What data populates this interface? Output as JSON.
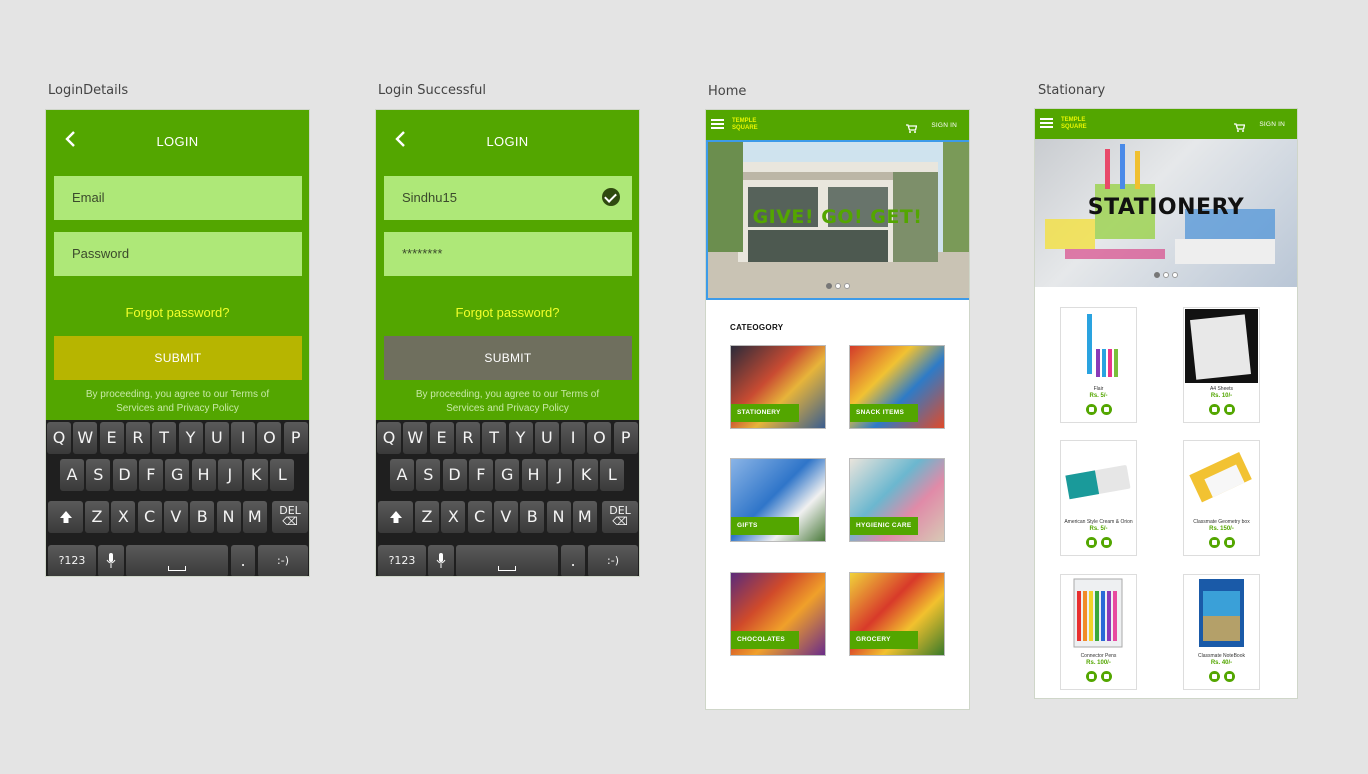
{
  "artboards": {
    "login_details": "LoginDetails",
    "login_success": "Login Successful",
    "home": "Home",
    "stationary": "Stationary"
  },
  "login_details": {
    "title": "LOGIN",
    "email_placeholder": "Email",
    "password_placeholder": "Password",
    "forgot": "Forgot password?",
    "submit": "SUBMIT",
    "terms": "By proceeding, you agree to our Terms of Services and Privacy Policy"
  },
  "login_success": {
    "title": "LOGIN",
    "username": "Sindhu15",
    "password": "********",
    "forgot": "Forgot password?",
    "submit": "SUBMIT",
    "terms": "By proceeding, you agree to our Terms of Services and Privacy Policy"
  },
  "keyboard": {
    "row1": [
      "Q",
      "W",
      "E",
      "R",
      "T",
      "Y",
      "U",
      "I",
      "O",
      "P"
    ],
    "row2": [
      "A",
      "S",
      "D",
      "F",
      "G",
      "H",
      "J",
      "K",
      "L"
    ],
    "row3": [
      "Z",
      "X",
      "C",
      "V",
      "B",
      "N",
      "M"
    ],
    "del": "DEL",
    "num": "?123",
    "period": ".",
    "smiley": ":-)"
  },
  "home": {
    "brand": "TEMPLE SQUARE",
    "sign_in": "SIGN IN",
    "hero_text": "GIVE! GO! GET!",
    "category_title": "CATEOGORY",
    "categories": [
      "STATIONERY",
      "SNACK ITEMS",
      "GIFTS",
      "HYGIENIC CARE",
      "CHOCOLATES",
      "GROCERY"
    ]
  },
  "stationary": {
    "brand": "TEMPLE SQUARE",
    "sign_in": "SIGN IN",
    "hero_text": "STATIONERY",
    "products": [
      {
        "name": "Flair",
        "price": "Rs. 5/-"
      },
      {
        "name": "A4 Sheets",
        "price": "Rs. 10/-"
      },
      {
        "name": "American Style Cream & Orion",
        "price": "Rs. 5/-"
      },
      {
        "name": "Classmate Geometry box",
        "price": "Rs. 150/-"
      },
      {
        "name": "Connector Pens",
        "price": "Rs. 100/-"
      },
      {
        "name": "Classmate NoteBook",
        "price": "Rs. 40/-"
      }
    ]
  },
  "colors": {
    "brand_green": "#53a600",
    "field_green": "#aee878",
    "forgot_yellow": "#f2ff2a",
    "submit_olive": "#b7b500",
    "submit_grey": "#6f6f5e"
  }
}
